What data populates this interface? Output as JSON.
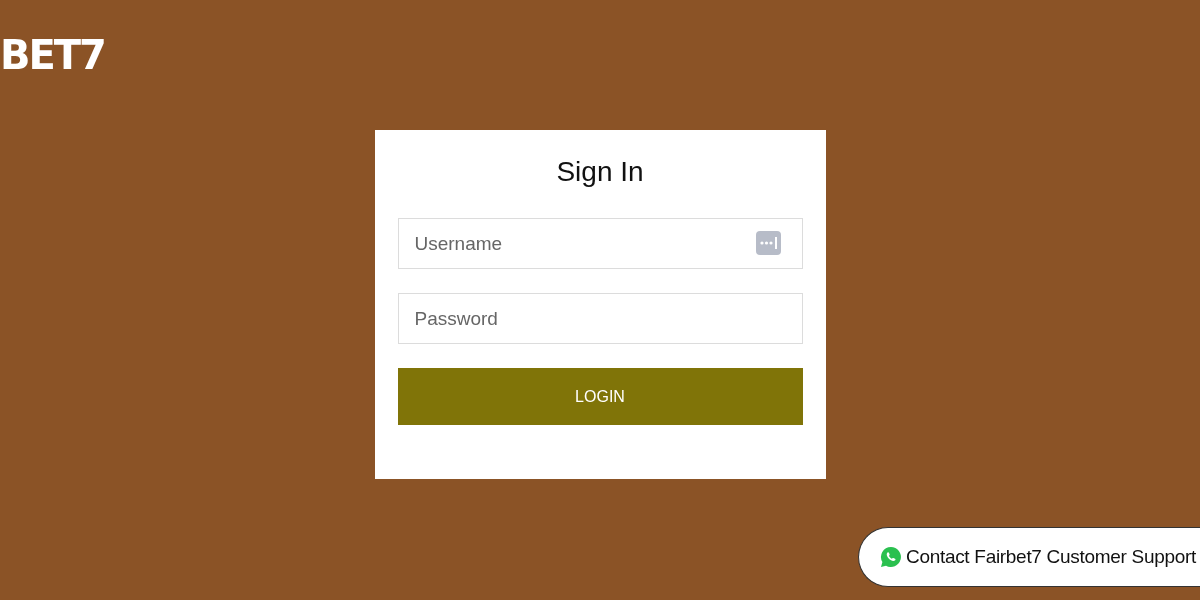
{
  "logo": "BET7",
  "form": {
    "title": "Sign In",
    "fields": [
      {
        "kind": "text",
        "placeholder": "Username"
      },
      {
        "kind": "password",
        "placeholder": "Password"
      }
    ],
    "button": "LOGIN"
  },
  "support": {
    "label": "Contact Fairbet7 Customer Support"
  }
}
